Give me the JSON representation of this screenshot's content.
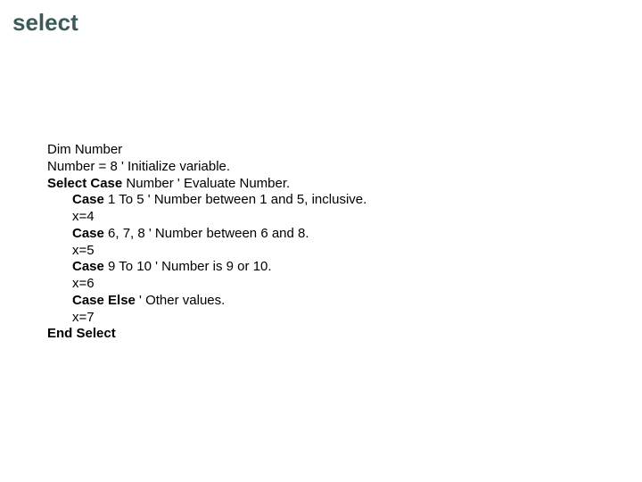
{
  "title": "select",
  "code": {
    "l1a": "Dim Number",
    "l2a": "Number = 8 ' Initialize variable.",
    "l3b": "Select Case",
    "l3a": " Number ' Evaluate Number.",
    "l4b": "Case",
    "l4a": " 1 To 5 ' Number between 1 and 5, inclusive.",
    "l5a": "x=4",
    "l6b": "Case",
    "l6a": " 6, 7, 8 ' Number between 6 and 8.",
    "l7a": "x=5",
    "l8b": "Case",
    "l8a": " 9 To 10 ' Number is 9 or 10.",
    "l9a": "x=6",
    "l10b": "Case Else",
    "l10a": " ' Other values.",
    "l11a": "x=7",
    "l12b": "End Select"
  }
}
